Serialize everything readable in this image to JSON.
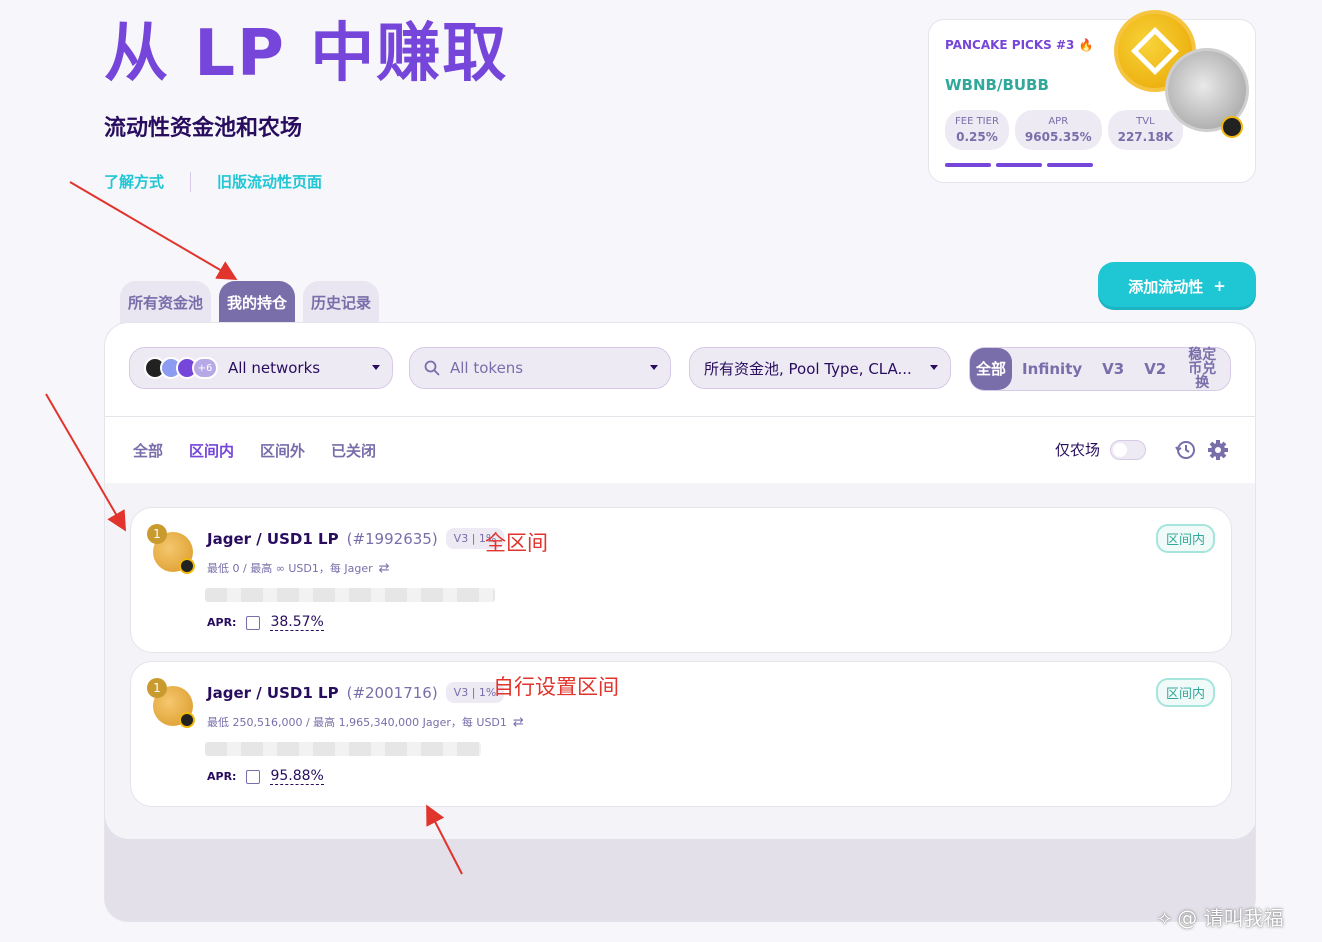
{
  "hero": {
    "title": "从 LP 中赚取",
    "subtitle": "流动性资金池和农场",
    "link_learn": "了解方式",
    "link_legacy": "旧版流动性页面"
  },
  "picks": {
    "title": "PANCAKE PICKS #3 🔥",
    "pair": "WBNB/BUBB",
    "fee_label": "FEE TIER",
    "fee_value": "0.25%",
    "apr_label": "APR",
    "apr_value": "9605.35%",
    "tvl_label": "TVL",
    "tvl_value": "227.18K"
  },
  "tabs": [
    "所有资金池",
    "我的持仓",
    "历史记录"
  ],
  "add_liquidity": {
    "label": "添加流动性",
    "icon": "+"
  },
  "toolbar": {
    "networks": {
      "label": "All networks",
      "more": "+6"
    },
    "tokens": {
      "placeholder": "All tokens"
    },
    "pool_type": {
      "label": "所有资金池, Pool Type, CLA..."
    },
    "versions": [
      "全部",
      "Infinity",
      "V3",
      "V2",
      "稳定币兑换"
    ]
  },
  "filters": [
    "全部",
    "区间内",
    "区间外",
    "已关闭"
  ],
  "farm_only": "仅农场",
  "positions": [
    {
      "index": "1",
      "pair": "Jager / USD1 LP",
      "id": "(#1992635)",
      "tag": "V3 | 1%",
      "range": "最低 0 / 最高 ∞ USD1，每 Jager",
      "apr_label": "APR:",
      "apr": "38.57%",
      "status": "区间内",
      "annotation": "全区间"
    },
    {
      "index": "1",
      "pair": "Jager / USD1 LP",
      "id": "(#2001716)",
      "tag": "V3 | 1%",
      "range": "最低 250,516,000 / 最高 1,965,340,000  Jager，每 USD1",
      "apr_label": "APR:",
      "apr": "95.88%",
      "status": "区间内",
      "annotation": "自行设置区间"
    }
  ],
  "watermark": "@ 请叫我福"
}
